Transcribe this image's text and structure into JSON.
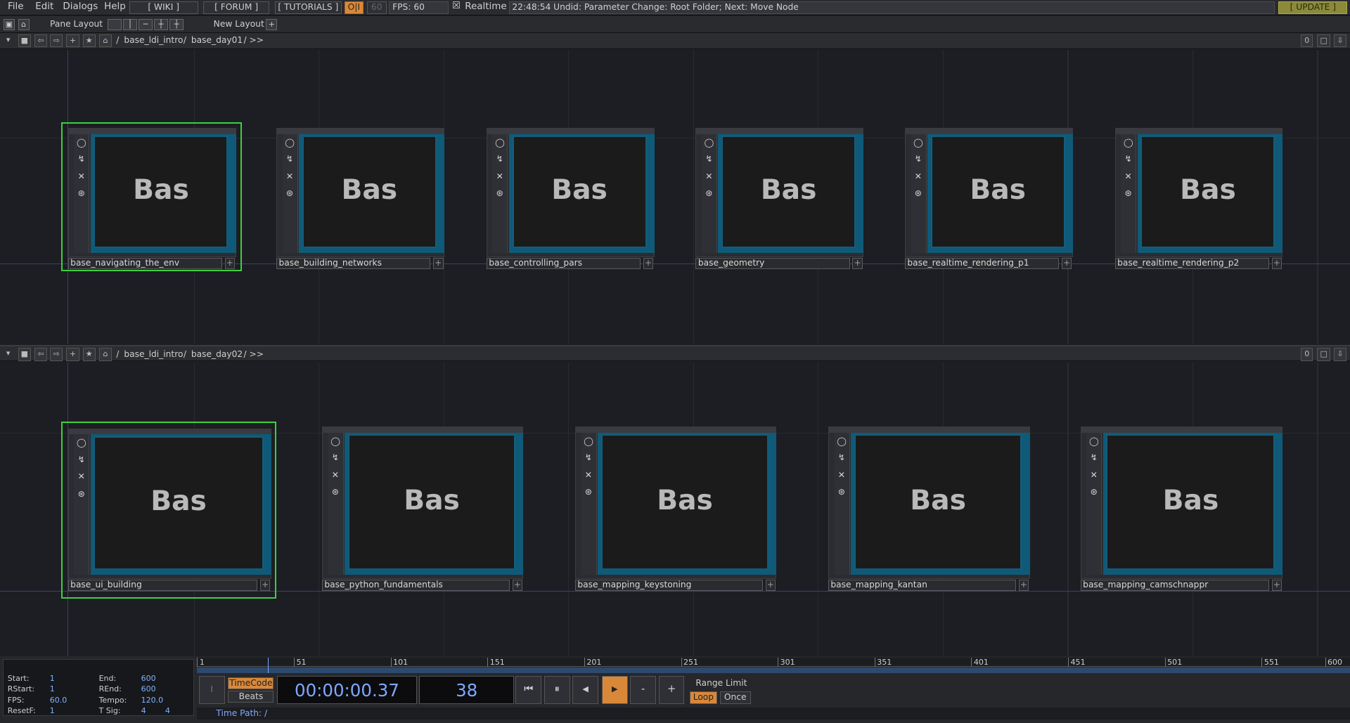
{
  "menu": {
    "file": "File",
    "edit": "Edit",
    "dialogs": "Dialogs",
    "help": "Help",
    "wiki": "[ WIKI ]",
    "forum": "[ FORUM ]",
    "tutorials": "[ TUTORIALS ]",
    "oi": "O|I",
    "fps_box": "60",
    "fps_label": "FPS:  60",
    "realtime_check": "☒",
    "realtime": "Realtime",
    "status": "22:48:54 Undid: Parameter Change: Root Folder; Next: Move Node",
    "update": "[ UPDATE ]"
  },
  "toolbar": {
    "pane_layout": "Pane Layout",
    "new_layout": "New Layout",
    "plus": "+"
  },
  "pane1": {
    "path_root": "/",
    "path_a": "base_ldi_intro",
    "sep": "/",
    "path_b": "base_day01",
    "path_more": "/ >>",
    "zero": "0",
    "nodes": [
      {
        "label": "base_navigating_the_env",
        "preview": "Bas"
      },
      {
        "label": "base_building_networks",
        "preview": "Bas"
      },
      {
        "label": "base_controlling_pars",
        "preview": "Bas"
      },
      {
        "label": "base_geometry",
        "preview": "Bas"
      },
      {
        "label": "base_realtime_rendering_p1",
        "preview": "Bas"
      },
      {
        "label": "base_realtime_rendering_p2",
        "preview": "Bas"
      }
    ]
  },
  "pane2": {
    "path_root": "/",
    "path_a": "base_ldi_intro",
    "sep": "/",
    "path_b": "base_day02",
    "path_more": "/ >>",
    "zero": "0",
    "nodes": [
      {
        "label": "base_ui_building",
        "preview": "Bas"
      },
      {
        "label": "base_python_fundamentals",
        "preview": "Bas"
      },
      {
        "label": "base_mapping_keystoning",
        "preview": "Bas"
      },
      {
        "label": "base_mapping_kantan",
        "preview": "Bas"
      },
      {
        "label": "base_mapping_camschnappr",
        "preview": "Bas"
      }
    ]
  },
  "ruler": [
    "1",
    "51",
    "101",
    "151",
    "201",
    "251",
    "301",
    "351",
    "401",
    "451",
    "501",
    "551",
    "600"
  ],
  "stats": {
    "start_l": "Start:",
    "start_v": "1",
    "end_l": "End:",
    "end_v": "600",
    "rstart_l": "RStart:",
    "rstart_v": "1",
    "rend_l": "REnd:",
    "rend_v": "600",
    "fps_l": "FPS:",
    "fps_v": "60.0",
    "tempo_l": "Tempo:",
    "tempo_v": "120.0",
    "resetf_l": "ResetF:",
    "resetf_v": "1",
    "tsig_l": "T Sig:",
    "tsig_a": "4",
    "tsig_b": "4"
  },
  "transport": {
    "timecode_btn": "TimeCode",
    "beats_btn": "Beats",
    "timecode": "00:00:00.37",
    "frame": "38",
    "range_limit": "Range Limit",
    "loop": "Loop",
    "once": "Once",
    "minus": "-",
    "plus": "+",
    "time_path": "Time Path: /",
    "i_btn": "I"
  },
  "colors": {
    "selected": "#3dd13d",
    "accent_orange": "#d9883a",
    "timecode_blue": "#7fa8ff"
  }
}
